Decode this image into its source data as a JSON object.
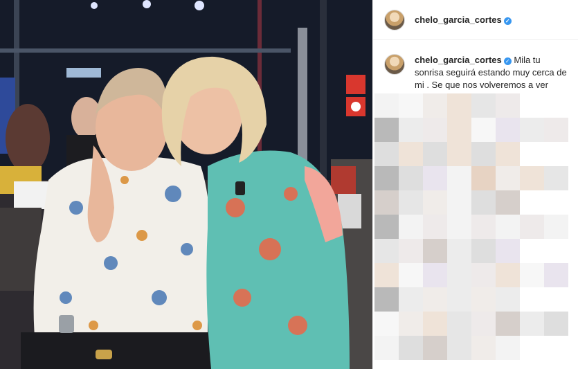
{
  "post": {
    "username": "chelo_garcia_cortes",
    "verified_icon": "verified-badge-icon",
    "caption_username": "chelo_garcia_cortes",
    "caption_text": "Mila tu sonrisa seguirá estando muy cerca de mi . Se que nos volveremos a ver amiga ."
  },
  "colors": {
    "verified": "#3897f0",
    "text": "#262626",
    "border": "#efefef"
  }
}
